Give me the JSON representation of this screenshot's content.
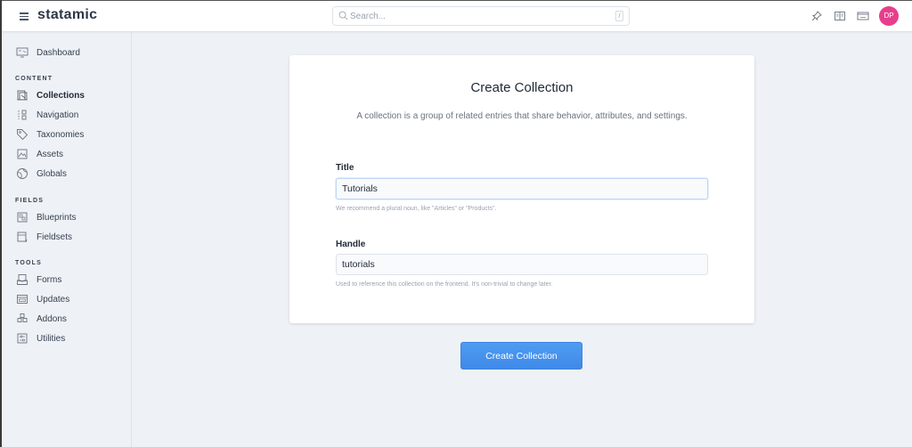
{
  "app": {
    "logo_text": "statamic"
  },
  "topbar": {
    "search": {
      "placeholder": "Search...",
      "shortcut": "/"
    },
    "icons": [
      "pin-icon",
      "book-icon",
      "site-icon"
    ],
    "avatar_initials": "DP",
    "avatar_color": "#e83e8c"
  },
  "sidebar": {
    "dashboard": {
      "label": "Dashboard",
      "icon": "dashboard-icon"
    },
    "sections": [
      {
        "title": "CONTENT",
        "items": [
          {
            "label": "Collections",
            "icon": "collections-icon",
            "active": true
          },
          {
            "label": "Navigation",
            "icon": "navigation-icon"
          },
          {
            "label": "Taxonomies",
            "icon": "tag-icon"
          },
          {
            "label": "Assets",
            "icon": "image-icon"
          },
          {
            "label": "Globals",
            "icon": "globe-icon"
          }
        ]
      },
      {
        "title": "FIELDS",
        "items": [
          {
            "label": "Blueprints",
            "icon": "blueprint-icon"
          },
          {
            "label": "Fieldsets",
            "icon": "fieldset-icon"
          }
        ]
      },
      {
        "title": "TOOLS",
        "items": [
          {
            "label": "Forms",
            "icon": "form-icon"
          },
          {
            "label": "Updates",
            "icon": "updates-icon"
          },
          {
            "label": "Addons",
            "icon": "addons-icon"
          },
          {
            "label": "Utilities",
            "icon": "utilities-icon"
          }
        ]
      }
    ]
  },
  "main": {
    "title": "Create Collection",
    "description": "A collection is a group of related entries that share behavior, attributes, and settings.",
    "fields": {
      "title": {
        "label": "Title",
        "value": "Tutorials",
        "help": "We recommend a plural noun, like \"Articles\" or \"Products\"."
      },
      "handle": {
        "label": "Handle",
        "value": "tutorials",
        "help": "Used to reference this collection on the frontend. It's non-trivial to change later."
      }
    },
    "submit_label": "Create Collection",
    "accent_color": "#4a90e8"
  }
}
